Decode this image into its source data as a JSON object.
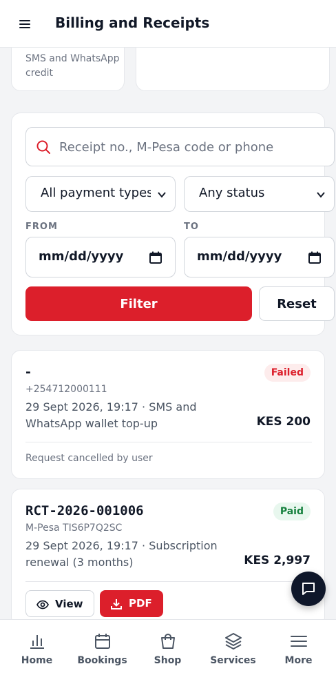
{
  "header": {
    "title": "Billing and Receipts"
  },
  "stats": {
    "card1_label": "SMS and WhatsApp credit"
  },
  "filters": {
    "search_placeholder": "Receipt no., M-Pesa code or phone",
    "payment_type": "All payment types",
    "status": "Any status",
    "from_label": "FROM",
    "to_label": "TO",
    "from_value": "mm/dd/yyyy",
    "to_value": "mm/dd/yyyy",
    "filter_label": "Filter",
    "reset_label": "Reset"
  },
  "receipts": [
    {
      "title": "-",
      "subtitle": "+254712000111",
      "description": "29 Sept 2026, 19:17 · SMS and WhatsApp wallet top-up",
      "amount": "KES 200",
      "status": "Failed",
      "note": "Request cancelled by user"
    },
    {
      "title": "RCT-2026-001006",
      "subtitle": "M-Pesa TIS6P7Q2SC",
      "description": "29 Sept 2026, 19:17 · Subscription renewal (3 months)",
      "amount": "KES 2,997",
      "status": "Paid",
      "view_label": "View",
      "pdf_label": "PDF"
    }
  ],
  "nav": [
    {
      "label": "Home",
      "icon": "bar-chart-icon"
    },
    {
      "label": "Bookings",
      "icon": "calendar-icon"
    },
    {
      "label": "Shop",
      "icon": "shopping-bag-icon"
    },
    {
      "label": "Services",
      "icon": "layers-icon"
    },
    {
      "label": "More",
      "icon": "menu-icon"
    }
  ],
  "colors": {
    "accent": "#dc1f2b",
    "failed": "#dc1f2b",
    "paid": "#15803d",
    "fab": "#0f172a"
  }
}
